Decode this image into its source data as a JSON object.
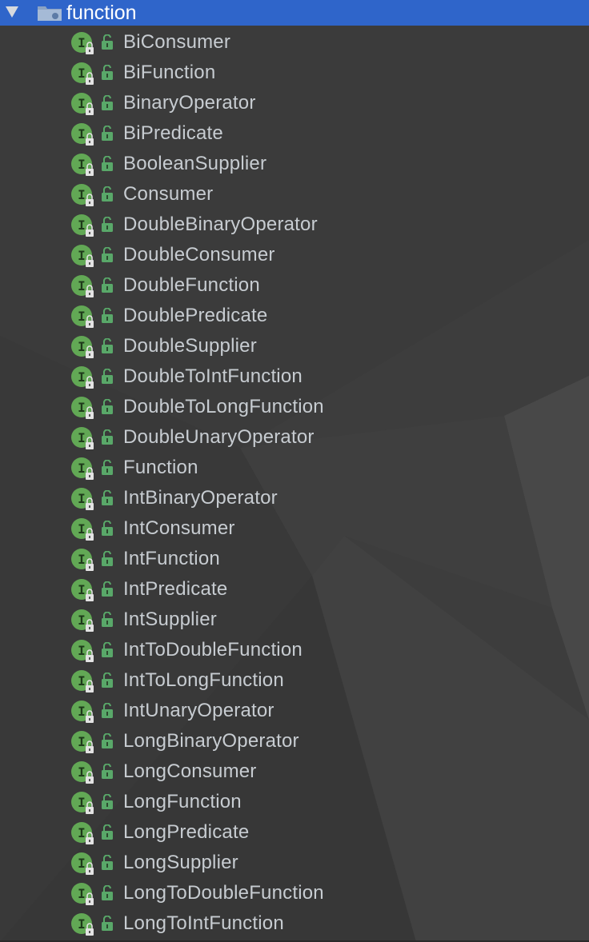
{
  "folder": {
    "name": "function",
    "expanded": true,
    "selected_color": "#2f65ca"
  },
  "items": [
    {
      "label": "BiConsumer"
    },
    {
      "label": "BiFunction"
    },
    {
      "label": "BinaryOperator"
    },
    {
      "label": "BiPredicate"
    },
    {
      "label": "BooleanSupplier"
    },
    {
      "label": "Consumer"
    },
    {
      "label": "DoubleBinaryOperator"
    },
    {
      "label": "DoubleConsumer"
    },
    {
      "label": "DoubleFunction"
    },
    {
      "label": "DoublePredicate"
    },
    {
      "label": "DoubleSupplier"
    },
    {
      "label": "DoubleToIntFunction"
    },
    {
      "label": "DoubleToLongFunction"
    },
    {
      "label": "DoubleUnaryOperator"
    },
    {
      "label": "Function"
    },
    {
      "label": "IntBinaryOperator"
    },
    {
      "label": "IntConsumer"
    },
    {
      "label": "IntFunction"
    },
    {
      "label": "IntPredicate"
    },
    {
      "label": "IntSupplier"
    },
    {
      "label": "IntToDoubleFunction"
    },
    {
      "label": "IntToLongFunction"
    },
    {
      "label": "IntUnaryOperator"
    },
    {
      "label": "LongBinaryOperator"
    },
    {
      "label": "LongConsumer"
    },
    {
      "label": "LongFunction"
    },
    {
      "label": "LongPredicate"
    },
    {
      "label": "LongSupplier"
    },
    {
      "label": "LongToDoubleFunction"
    },
    {
      "label": "LongToIntFunction"
    }
  ],
  "icons": {
    "interface_icon": "interface-icon",
    "interface_letter": "I",
    "interface_color": "#62a855",
    "access_icon": "public-lock-icon",
    "access_color": "#59a869"
  }
}
